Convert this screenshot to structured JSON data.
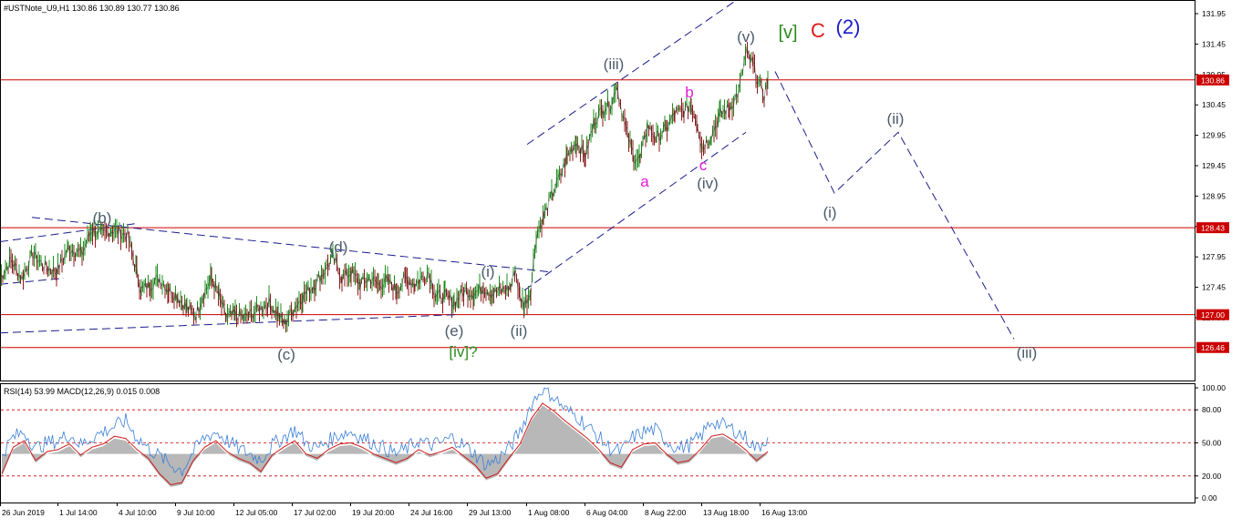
{
  "header": {
    "symbol_line": "#USTNote_U9,H1  130.86 130.89 130.77 130.86",
    "indicator_line": "RSI(14) 53.99 MACD(12,26,9) 0.015 0.008"
  },
  "chart_data": [
    {
      "type": "line",
      "title": "#USTNote_U9,H1",
      "ohlc_last": {
        "open": 130.86,
        "high": 130.89,
        "low": 130.77,
        "close": 130.86
      },
      "ylim": [
        126.0,
        132.2
      ],
      "y_ticks": [
        "131.95",
        "131.45",
        "130.95",
        "130.45",
        "129.95",
        "129.45",
        "128.95",
        "128.45",
        "127.95",
        "127.45",
        "126.95"
      ],
      "x_ticks": [
        "26 Jun 2019",
        "1 Jul 14:00",
        "4 Jul 10:00",
        "9 Jul 10:00",
        "12 Jul 05:00",
        "17 Jul 02:00",
        "19 Jul 20:00",
        "24 Jul 16:00",
        "29 Jul 13:00",
        "1 Aug 08:00",
        "6 Aug 04:00",
        "8 Aug 22:00",
        "13 Aug 18:00",
        "16 Aug 13:00"
      ],
      "horizontal_levels": [
        {
          "value": 130.86,
          "label": "130.86",
          "color": "#cc0000"
        },
        {
          "value": 128.43,
          "label": "128.43",
          "color": "#cc0000"
        },
        {
          "value": 127.0,
          "label": "127.00",
          "color": "#cc0000"
        },
        {
          "value": 126.46,
          "label": "126.46",
          "color": "#cc0000"
        }
      ],
      "price_series": [
        [
          0,
          127.6
        ],
        [
          12,
          127.9
        ],
        [
          24,
          127.6
        ],
        [
          36,
          128.0
        ],
        [
          48,
          127.8
        ],
        [
          62,
          127.7
        ],
        [
          75,
          128.1
        ],
        [
          90,
          128.0
        ],
        [
          100,
          128.4
        ],
        [
          112,
          128.3
        ],
        [
          122,
          128.4
        ],
        [
          140,
          128.3
        ],
        [
          150,
          127.7
        ],
        [
          155,
          127.4
        ],
        [
          165,
          127.5
        ],
        [
          175,
          127.6
        ],
        [
          185,
          127.4
        ],
        [
          195,
          127.3
        ],
        [
          205,
          127.1
        ],
        [
          215,
          127.0
        ],
        [
          222,
          127.3
        ],
        [
          232,
          127.6
        ],
        [
          240,
          127.3
        ],
        [
          248,
          126.95
        ],
        [
          258,
          127.0
        ],
        [
          268,
          126.95
        ],
        [
          280,
          127.05
        ],
        [
          295,
          127.2
        ],
        [
          305,
          127.0
        ],
        [
          312,
          126.85
        ],
        [
          322,
          127.1
        ],
        [
          332,
          127.3
        ],
        [
          345,
          127.5
        ],
        [
          355,
          127.7
        ],
        [
          365,
          127.95
        ],
        [
          375,
          127.6
        ],
        [
          385,
          127.7
        ],
        [
          395,
          127.5
        ],
        [
          405,
          127.6
        ],
        [
          415,
          127.5
        ],
        [
          425,
          127.55
        ],
        [
          435,
          127.4
        ],
        [
          445,
          127.6
        ],
        [
          455,
          127.5
        ],
        [
          470,
          127.7
        ],
        [
          478,
          127.3
        ],
        [
          488,
          127.3
        ],
        [
          498,
          127.2
        ],
        [
          510,
          127.4
        ],
        [
          520,
          127.35
        ],
        [
          530,
          127.45
        ],
        [
          540,
          127.35
        ],
        [
          550,
          127.4
        ],
        [
          560,
          127.45
        ],
        [
          565,
          127.75
        ],
        [
          570,
          127.3
        ],
        [
          575,
          127.15
        ],
        [
          582,
          127.4
        ],
        [
          588,
          128.3
        ],
        [
          596,
          128.6
        ],
        [
          606,
          129.0
        ],
        [
          615,
          129.3
        ],
        [
          622,
          129.6
        ],
        [
          632,
          129.85
        ],
        [
          642,
          129.6
        ],
        [
          652,
          130.2
        ],
        [
          662,
          130.4
        ],
        [
          672,
          130.5
        ],
        [
          676,
          130.8
        ],
        [
          682,
          130.35
        ],
        [
          688,
          129.95
        ],
        [
          695,
          129.6
        ],
        [
          702,
          129.55
        ],
        [
          710,
          130.1
        ],
        [
          720,
          129.9
        ],
        [
          730,
          130.05
        ],
        [
          740,
          130.3
        ],
        [
          750,
          130.35
        ],
        [
          758,
          130.45
        ],
        [
          765,
          130.15
        ],
        [
          770,
          129.75
        ],
        [
          780,
          129.95
        ],
        [
          790,
          130.3
        ],
        [
          800,
          130.4
        ],
        [
          810,
          130.65
        ],
        [
          818,
          131.3
        ],
        [
          826,
          131.1
        ],
        [
          832,
          130.8
        ],
        [
          838,
          130.6
        ],
        [
          842,
          130.86
        ]
      ],
      "wave_projection": [
        [
          850,
          131.0
        ],
        [
          915,
          129.0
        ],
        [
          985,
          130.0
        ],
        [
          1112,
          126.6
        ]
      ],
      "trendlines": [
        {
          "from": [
            0,
            128.2
          ],
          "to": [
            150,
            128.5
          ]
        },
        {
          "from": [
            0,
            127.5
          ],
          "to": [
            70,
            127.6
          ]
        },
        {
          "from": [
            0,
            126.7
          ],
          "to": [
            500,
            127.0
          ]
        },
        {
          "from": [
            35,
            128.6
          ],
          "to": [
            605,
            127.7
          ]
        },
        {
          "from": [
            575,
            127.4
          ],
          "to": [
            818,
            130.0
          ]
        },
        {
          "from": [
            578,
            129.8
          ],
          "to": [
            820,
            132.3
          ]
        }
      ],
      "annotations": [
        {
          "text": "(b)",
          "color": "#4a5a6a"
        },
        {
          "text": "(c)",
          "color": "#4a5a6a"
        },
        {
          "text": "(d)",
          "color": "#4a5a6a"
        },
        {
          "text": "(e)",
          "color": "#4a5a6a"
        },
        {
          "text": "[iv]?",
          "color": "#2e8b1e"
        },
        {
          "text": "(i)",
          "color": "#4a5a6a"
        },
        {
          "text": "(ii)",
          "color": "#4a5a6a"
        },
        {
          "text": "(iii)",
          "color": "#4a5a6a"
        },
        {
          "text": "a",
          "color": "#e21ad8"
        },
        {
          "text": "b",
          "color": "#e21ad8"
        },
        {
          "text": "c",
          "color": "#e21ad8"
        },
        {
          "text": "(iv)",
          "color": "#4a5a6a"
        },
        {
          "text": "(v)",
          "color": "#4a5a6a"
        },
        {
          "text": "[v]",
          "color": "#2e8b1e"
        },
        {
          "text": "C",
          "color": "#e01818"
        },
        {
          "text": "(2)",
          "color": "#1a1acc"
        },
        {
          "text": "(i)",
          "color": "#4a5a6a"
        },
        {
          "text": "(ii)",
          "color": "#4a5a6a"
        },
        {
          "text": "(iii)",
          "color": "#4a5a6a"
        }
      ]
    },
    {
      "type": "area",
      "title": "RSI(14) 53.99 MACD(12,26,9) 0.015 0.008",
      "ylim": [
        0,
        100
      ],
      "y_ticks": [
        "100.00",
        "80.00",
        "50.00",
        "20.00",
        "0.00"
      ],
      "levels": [
        80,
        50,
        20
      ],
      "series": [
        {
          "values": [
            40,
            55,
            60,
            45,
            50,
            52,
            58,
            48,
            55,
            60,
            65,
            70,
            55,
            45,
            38,
            30,
            25,
            42,
            55,
            60,
            52,
            45,
            40,
            35,
            48,
            55,
            62,
            50,
            45,
            52,
            58,
            60,
            55,
            50,
            45,
            40,
            45,
            52,
            48,
            50,
            55,
            48,
            40,
            30,
            35,
            45,
            60,
            85,
            100,
            92,
            80,
            75,
            65,
            55,
            45,
            42,
            55,
            60,
            62,
            52,
            45,
            48,
            55,
            70,
            66,
            62,
            55,
            45,
            55
          ]
        },
        {
          "values": [
            28,
            52,
            58,
            40,
            48,
            50,
            55,
            45,
            52,
            55,
            62,
            60,
            50,
            42,
            28,
            18,
            20,
            40,
            52,
            58,
            48,
            42,
            38,
            30,
            45,
            52,
            58,
            46,
            42,
            50,
            55,
            56,
            52,
            46,
            42,
            38,
            42,
            50,
            45,
            48,
            52,
            44,
            36,
            24,
            28,
            42,
            55,
            78,
            92,
            85,
            76,
            68,
            60,
            50,
            38,
            34,
            50,
            55,
            56,
            46,
            38,
            40,
            50,
            62,
            64,
            58,
            50,
            40,
            48
          ]
        }
      ]
    }
  ]
}
